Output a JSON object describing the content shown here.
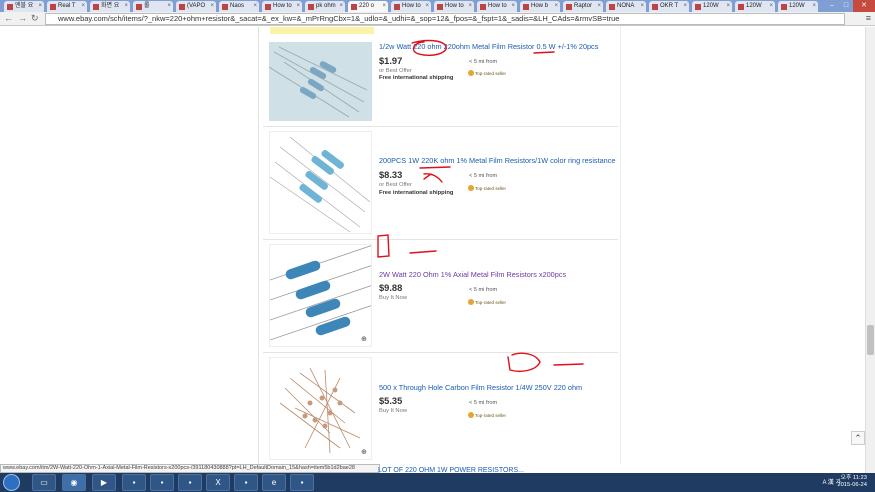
{
  "browser": {
    "tabs": [
      {
        "label": "엔블 요"
      },
      {
        "label": "Real T"
      },
      {
        "label": "화면 요"
      },
      {
        "label": "롤"
      },
      {
        "label": "(VAPO"
      },
      {
        "label": "Naos"
      },
      {
        "label": "How to"
      },
      {
        "label": "pk ohm"
      },
      {
        "label": "220 o"
      },
      {
        "label": "How to"
      },
      {
        "label": "How to"
      },
      {
        "label": "How to"
      },
      {
        "label": "How b"
      },
      {
        "label": "Raptor"
      },
      {
        "label": "NONA"
      },
      {
        "label": "OKR T"
      },
      {
        "label": "120W"
      },
      {
        "label": "120W"
      },
      {
        "label": "120W"
      }
    ],
    "active_tab_index": 8,
    "url": "www.ebay.com/sch/items/?_nkw=220+ohm+resistor&_sacat=&_ex_kw=&_mPrRngCbx=1&_udlo=&_udhi=&_sop=12&_fpos=&_fspt=1&_sadis=&LH_CAds=&rmvSB=true",
    "status_url": "www.ebay.com/itm/2W-Watt-220-Ohm-1-Axial-Metal-Film-Resistors-x200pcs-/391180430888?pt=LH_DefaultDomain_15&hash=item5b1d2bae28"
  },
  "listings": [
    {
      "title_parts": [
        "1/2w Watt ",
        "220 ohm",
        " 220ohm Metal Film Resistor ",
        "0.5 W",
        " +/-1% 20pcs"
      ],
      "price": "$1.97",
      "format": "or Best Offer",
      "shipping": "Free international shipping",
      "distance": "< 5 mi from",
      "badge": "Top-rated seller"
    },
    {
      "title_parts": [
        "200PCS 1W ",
        "220K ohm",
        " 1% Metal Film Resistors/1W color ring resistance"
      ],
      "price": "$8.33",
      "format": "or Best Offer",
      "shipping": "Free international shipping",
      "distance": "< 5 mi from",
      "badge": "Top-rated seller"
    },
    {
      "title_parts": [
        "2W",
        " Watt ",
        "220 Ohm",
        " 1% Axial Metal Film Resistors x200pcs"
      ],
      "price": "$9.88",
      "format": "Buy It Now",
      "shipping": "",
      "distance": "< 5 mi from",
      "badge": "Top-rated seller"
    },
    {
      "title_parts": [
        "500 x Through Hole Carbon Film Resistor ",
        "1/4W",
        " 250V ",
        "220 ohm"
      ],
      "price": "$5.35",
      "format": "Buy It Now",
      "shipping": "",
      "distance": "< 5 mi from",
      "badge": "Top-rated seller"
    }
  ],
  "next_listing_partial": "LOT OF 220 OHM 1W POWER RESISTORS...",
  "taskbar": {
    "tray_text": "A 漢 가",
    "time": "오후 11:23",
    "date": "2015-06-24"
  },
  "colors": {
    "link": "#1a5cb0",
    "visited_link": "#6b3aa6",
    "annotation_ink": "#e0101a",
    "taskbar": "#1f3b62"
  }
}
